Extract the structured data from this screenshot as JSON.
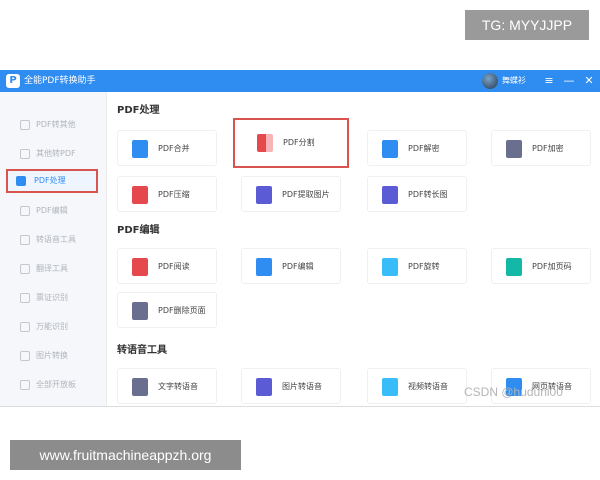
{
  "overlay": {
    "tag": "TG: MYYJJPP",
    "watermark": "CSDN @huduni00",
    "url": "www.fruitmachineappzh.org"
  },
  "window": {
    "title": "全能PDF转换助手",
    "logo_char": "P",
    "username": "舞蝶衫",
    "controls": {
      "menu": "≡",
      "minimize": "—",
      "close": "✕"
    }
  },
  "sidebar": {
    "items": [
      {
        "label": "PDF转其他"
      },
      {
        "label": "其他转PDF"
      },
      {
        "label": "PDF处理"
      },
      {
        "label": "PDF编辑"
      },
      {
        "label": "转语音工具"
      },
      {
        "label": "翻译工具"
      },
      {
        "label": "票证识别"
      },
      {
        "label": "万能识别"
      },
      {
        "label": "图片转换"
      },
      {
        "label": "全部开放板"
      }
    ],
    "active": "PDF处理"
  },
  "sections": [
    {
      "title": "PDF处理",
      "cards": [
        {
          "label": "PDF合并",
          "icon": "merge-icon"
        },
        {
          "label": "PDF分割",
          "icon": "split-icon"
        },
        {
          "label": "PDF解密",
          "icon": "unlock-icon"
        },
        {
          "label": "PDF加密",
          "icon": "lock-icon"
        },
        {
          "label": "PDF压缩",
          "icon": "compress-icon"
        },
        {
          "label": "PDF提取图片",
          "icon": "image-extract-icon"
        },
        {
          "label": "PDF转长图",
          "icon": "long-image-icon"
        }
      ]
    },
    {
      "title": "PDF编辑",
      "cards": [
        {
          "label": "PDF阅读",
          "icon": "book-icon"
        },
        {
          "label": "PDF编辑",
          "icon": "edit-icon"
        },
        {
          "label": "PDF旋转",
          "icon": "rotate-icon"
        },
        {
          "label": "PDF加页码",
          "icon": "add-page-number-icon"
        },
        {
          "label": "PDF删除页面",
          "icon": "delete-page-icon"
        }
      ]
    },
    {
      "title": "转语音工具",
      "cards": [
        {
          "label": "文字转语音",
          "icon": "text-to-speech-icon"
        },
        {
          "label": "图片转语音",
          "icon": "image-to-speech-icon"
        },
        {
          "label": "视频转语音",
          "icon": "video-to-speech-icon"
        },
        {
          "label": "网页转语音",
          "icon": "web-to-speech-icon"
        }
      ]
    }
  ],
  "colors": {
    "titlebar": "#2f8cf0",
    "highlight_border": "#d9534f"
  }
}
